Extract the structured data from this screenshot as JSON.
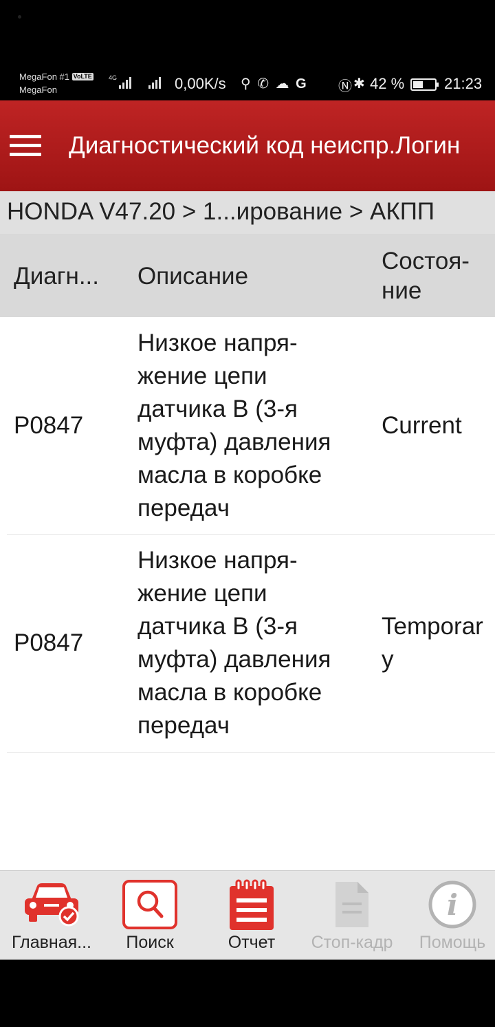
{
  "status_bar": {
    "carrier1": "MegaFon #1",
    "volte": "VoLTE",
    "carrier2": "MegaFon",
    "net_type": "4G",
    "speed": "0,00K/s",
    "battery_pct": "42 %",
    "time": "21:23"
  },
  "app_bar": {
    "title": "Диагностический код неиспр.Логин"
  },
  "breadcrumb": "HONDA V47.20 > 1...ирование > АКПП",
  "table": {
    "headers": {
      "code": "Диагн...",
      "description": "Описание",
      "status": "Состоя-\nние"
    },
    "rows": [
      {
        "code": "P0847",
        "description": "Низкое напря-\nжение цепи\nдатчика B (3-я\nмуфта) давления\nмасла в коробке\nпередач",
        "status": "Current"
      },
      {
        "code": "P0847",
        "description": "Низкое напря-\nжение цепи\nдатчика B (3-я\nмуфта) давления\nмасла в коробке\nпередач",
        "status": "Temporary"
      }
    ]
  },
  "bottom_nav": [
    {
      "label": "Главная...",
      "icon": "car-check-icon",
      "enabled": true
    },
    {
      "label": "Поиск",
      "icon": "search-icon",
      "enabled": true
    },
    {
      "label": "Отчет",
      "icon": "report-icon",
      "enabled": true
    },
    {
      "label": "Стоп-кадр",
      "icon": "document-icon",
      "enabled": false
    },
    {
      "label": "Помощь",
      "icon": "info-icon",
      "enabled": false
    }
  ],
  "colors": {
    "app_bar": "#b01c1c",
    "accent_red": "#e0322c",
    "disabled": "#b3b3b3"
  }
}
